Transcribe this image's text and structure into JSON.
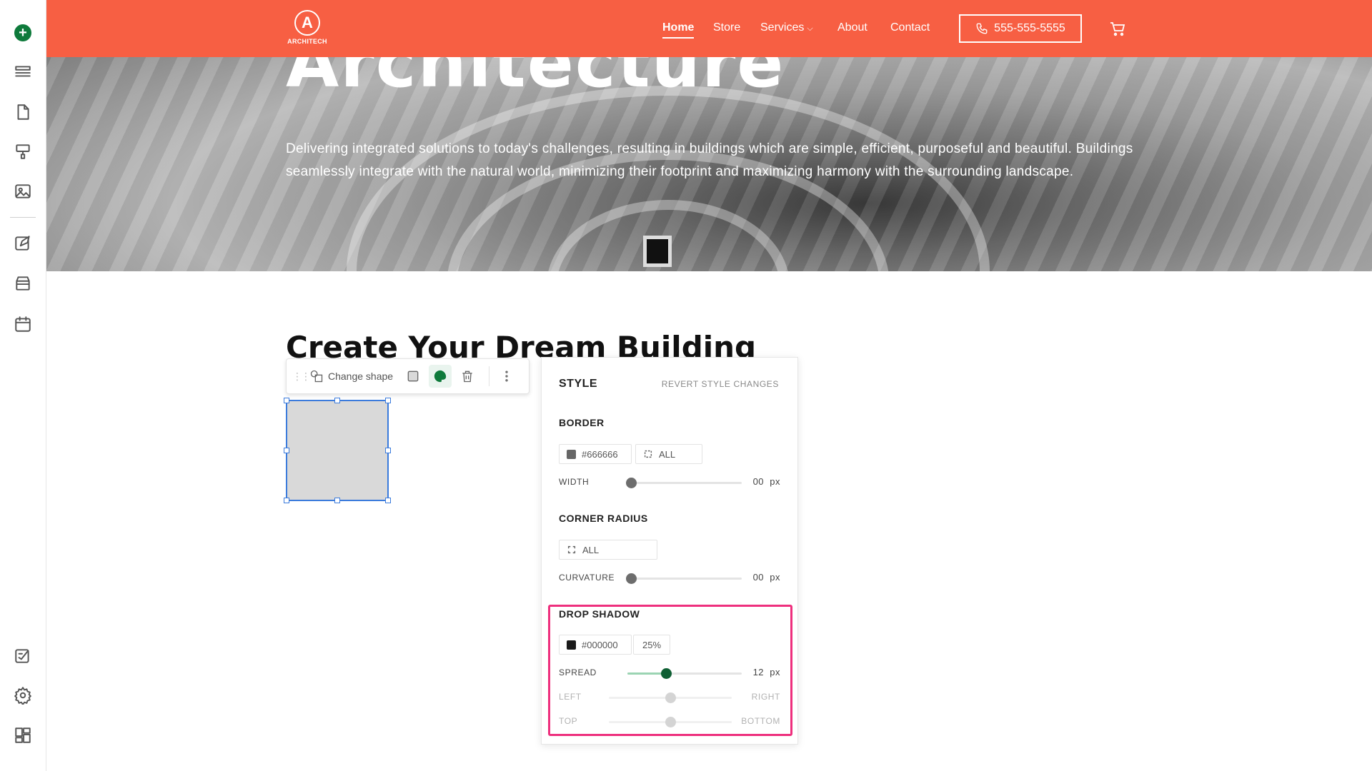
{
  "sidebar": {
    "add_label": "+",
    "icons": [
      "add-icon",
      "layers-icon",
      "page-icon",
      "brush-icon",
      "image-icon",
      "edit-icon",
      "store-icon",
      "calendar-icon",
      "blog-icon",
      "settings-icon",
      "apps-icon"
    ]
  },
  "nav": {
    "logo_text": "ARCHITECH",
    "logo_letter": "A",
    "items": [
      "Home",
      "Store",
      "Services",
      "About",
      "Contact"
    ],
    "phone": "555-555-5555",
    "accent": "#f75f43"
  },
  "hero": {
    "title": "Architecture",
    "text": "Delivering integrated solutions to today's challenges, resulting in buildings which are simple, efficient, purposeful and beautiful. Buildings seamlessly integrate with the natural world, minimizing their footprint and maximizing harmony with the surrounding landscape."
  },
  "section": {
    "title": "Create Your Dream Building"
  },
  "toolbar": {
    "change_shape": "Change shape"
  },
  "style_panel": {
    "title": "STYLE",
    "revert": "REVERT STYLE CHANGES",
    "border": {
      "heading": "BORDER",
      "color": "#666666",
      "sides": "ALL",
      "width_label": "WIDTH",
      "width_value": "00",
      "width_unit": "px"
    },
    "corner_radius": {
      "heading": "CORNER RADIUS",
      "corners": "ALL",
      "curvature_label": "CURVATURE",
      "curvature_value": "00",
      "curvature_unit": "px"
    },
    "drop_shadow": {
      "heading": "DROP SHADOW",
      "color": "#000000",
      "opacity": "25%",
      "spread_label": "SPREAD",
      "spread_value": "12",
      "spread_unit": "px",
      "spread_level": 0.34,
      "left_label": "LEFT",
      "right_label": "RIGHT",
      "horizontal_level": 0.5,
      "top_label": "TOP",
      "bottom_label": "BOTTOM",
      "vertical_level": 0.5
    }
  }
}
